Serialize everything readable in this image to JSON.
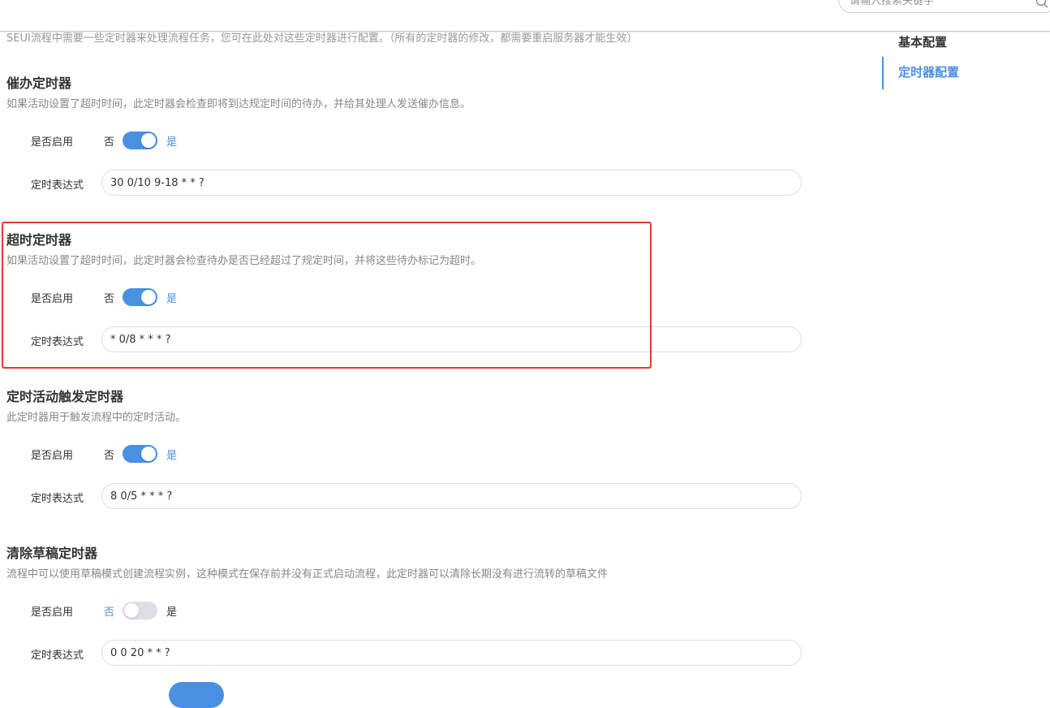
{
  "search": {
    "placeholder": "请输入搜索关键字"
  },
  "intro": "SEUI流程中需要一些定时器来处理流程任务，您可在此处对这些定时器进行配置。（所有的定时器的修改，都需要重启服务器才能生效）",
  "nav": {
    "items": [
      {
        "label": "基本配置",
        "active": false
      },
      {
        "label": "定时器配置",
        "active": true
      }
    ]
  },
  "common": {
    "enable_label": "是否启用",
    "off_label": "否",
    "on_label": "是",
    "expr_label": "定时表达式"
  },
  "sections": [
    {
      "title": "催办定时器",
      "desc": "如果活动设置了超时时间，此定时器会检查即将到达规定时间的待办，并给其处理人发送催办信息。",
      "enabled": true,
      "expression": "30 0/10 9-18 * * ?"
    },
    {
      "title": "超时定时器",
      "desc": "如果活动设置了超时时间，此定时器会检查待办是否已经超过了规定时间，并将这些待办标记为超时。",
      "enabled": true,
      "expression": "* 0/8 * * * ?"
    },
    {
      "title": "定时活动触发定时器",
      "desc": "此定时器用于触发流程中的定时活动。",
      "enabled": true,
      "expression": "8 0/5 * * * ?"
    },
    {
      "title": "清除草稿定时器",
      "desc": "流程中可以使用草稿模式创建流程实例，这种模式在保存前并没有正式启动流程，此定时器可以清除长期没有进行流转的草稿文件",
      "enabled": false,
      "expression": "0 0 20 * * ?"
    }
  ],
  "colors": {
    "accent": "#4a90e2",
    "highlight": "#e53935",
    "switch_off": "#dcdfe6"
  }
}
